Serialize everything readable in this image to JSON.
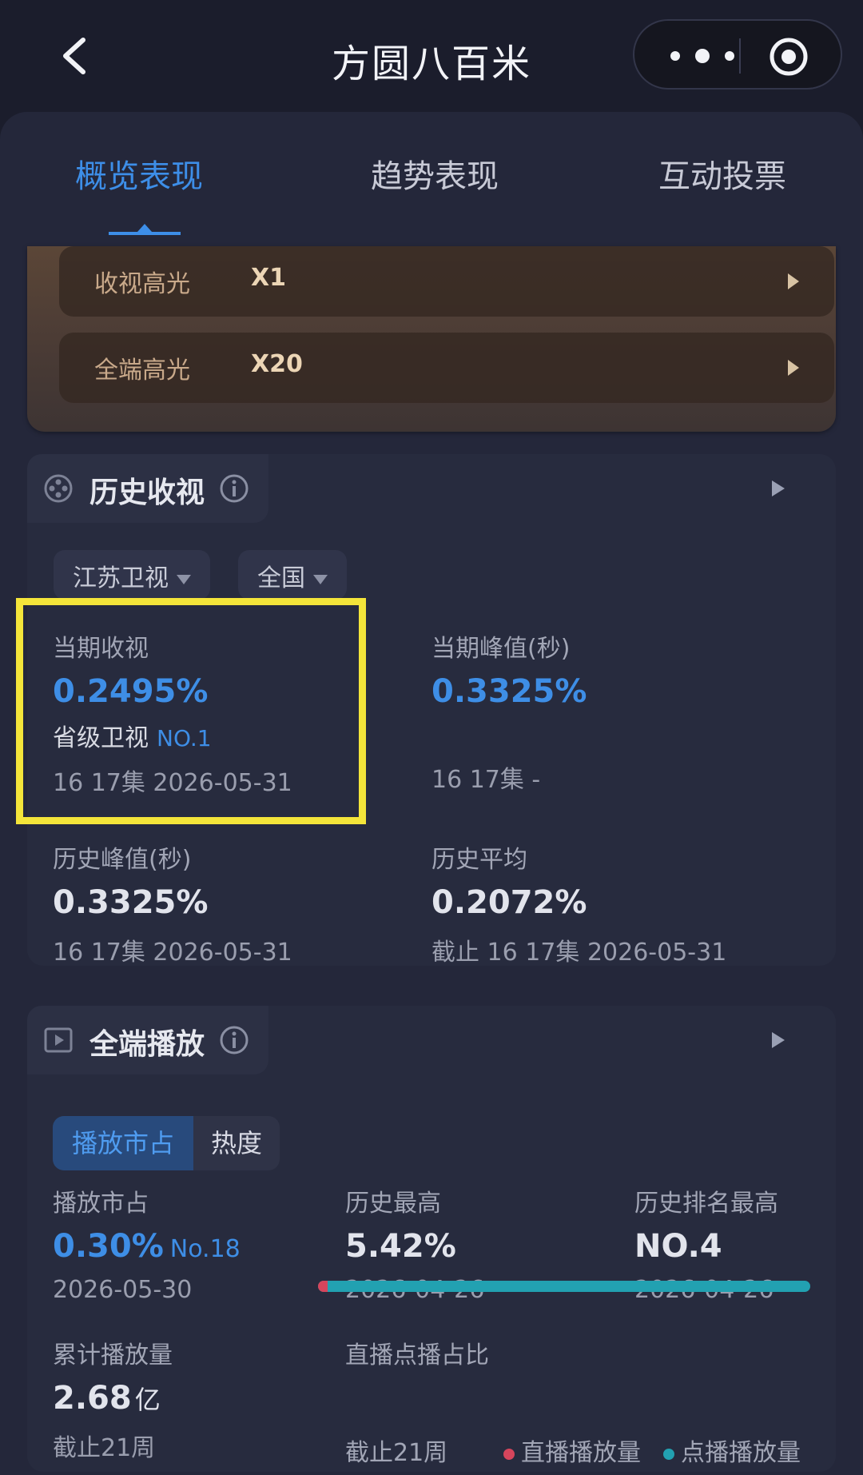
{
  "header": {
    "title": "方圆八百米"
  },
  "tabs": [
    "概览表现",
    "趋势表现",
    "互动投票"
  ],
  "highlights": [
    {
      "label": "收视高光",
      "value": "X1"
    },
    {
      "label": "全端高光",
      "value": "X20"
    }
  ],
  "history": {
    "title": "历史收视",
    "filters": [
      "江苏卫视",
      "全国"
    ],
    "current": {
      "label": "当期收视",
      "value": "0.2495%",
      "rank_label": "省级卫视",
      "rank": "NO.1",
      "sub": "16 17集  2026-05-31"
    },
    "current_peak": {
      "label": "当期峰值(秒)",
      "value": "0.3325%",
      "sub": "16 17集  -"
    },
    "history_peak": {
      "label": "历史峰值(秒)",
      "value": "0.3325%",
      "sub": "16 17集  2026-05-31"
    },
    "history_avg": {
      "label": "历史平均",
      "value": "0.2072%",
      "sub": "截止 16 17集  2026-05-31"
    }
  },
  "all_platform": {
    "title": "全端播放",
    "segments": [
      "播放市占",
      "热度"
    ],
    "share": {
      "label": "播放市占",
      "value": "0.30%",
      "rank": "No.18",
      "date": "2026-05-30"
    },
    "history_high": {
      "label": "历史最高",
      "value": "5.42%",
      "date": "2026-04-26"
    },
    "rank_high": {
      "label": "历史排名最高",
      "value": "NO.4",
      "date": "2026-04-26"
    },
    "total": {
      "label": "累计播放量",
      "value": "2.68",
      "unit": "亿",
      "sub": "截止21周"
    },
    "ratio": {
      "label": "直播点播占比",
      "sub": "截止21周",
      "live_fraction": 0.02,
      "legend_live": "直播播放量",
      "legend_vod": "点播播放量",
      "live_color": "#d6455c",
      "vod_color": "#22a1b1"
    }
  },
  "colors": {
    "accent": "#3d8ee8",
    "highlight_box": "#f4e53a"
  }
}
